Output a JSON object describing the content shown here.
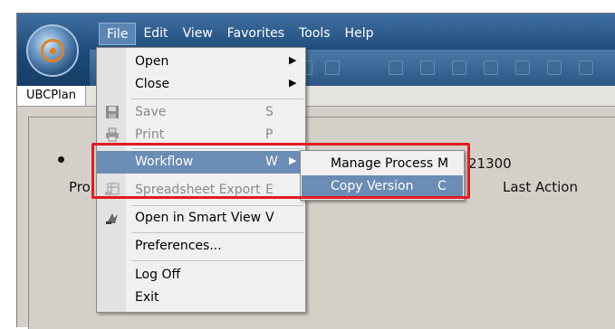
{
  "window": {
    "menubar": [
      "File",
      "Edit",
      "View",
      "Favorites",
      "Tools",
      "Help"
    ],
    "tab_label": "UBCPlan"
  },
  "background": {
    "number_fragment": "21300",
    "col_left_label": "Pro",
    "col_right_label": "Last Action",
    "bullet_fragment": "■"
  },
  "file_menu": {
    "open": "Open",
    "close": "Close",
    "save": "Save",
    "save_key": "S",
    "print": "Print",
    "print_key": "P",
    "workflow": "Workflow",
    "workflow_key": "W",
    "spreadsheet_export": "Spreadsheet Export",
    "spreadsheet_key": "E",
    "open_smart_view": "Open in Smart View",
    "smart_view_key": "V",
    "preferences": "Preferences...",
    "log_off": "Log Off",
    "exit": "Exit"
  },
  "workflow_submenu": {
    "manage_process": "Manage Process",
    "manage_key": "M",
    "copy_version": "Copy Version",
    "copy_key": "C"
  },
  "colors": {
    "highlight": "#6b8cb4",
    "annotation": "#e01b24",
    "titlebar": "#1d4a78"
  }
}
